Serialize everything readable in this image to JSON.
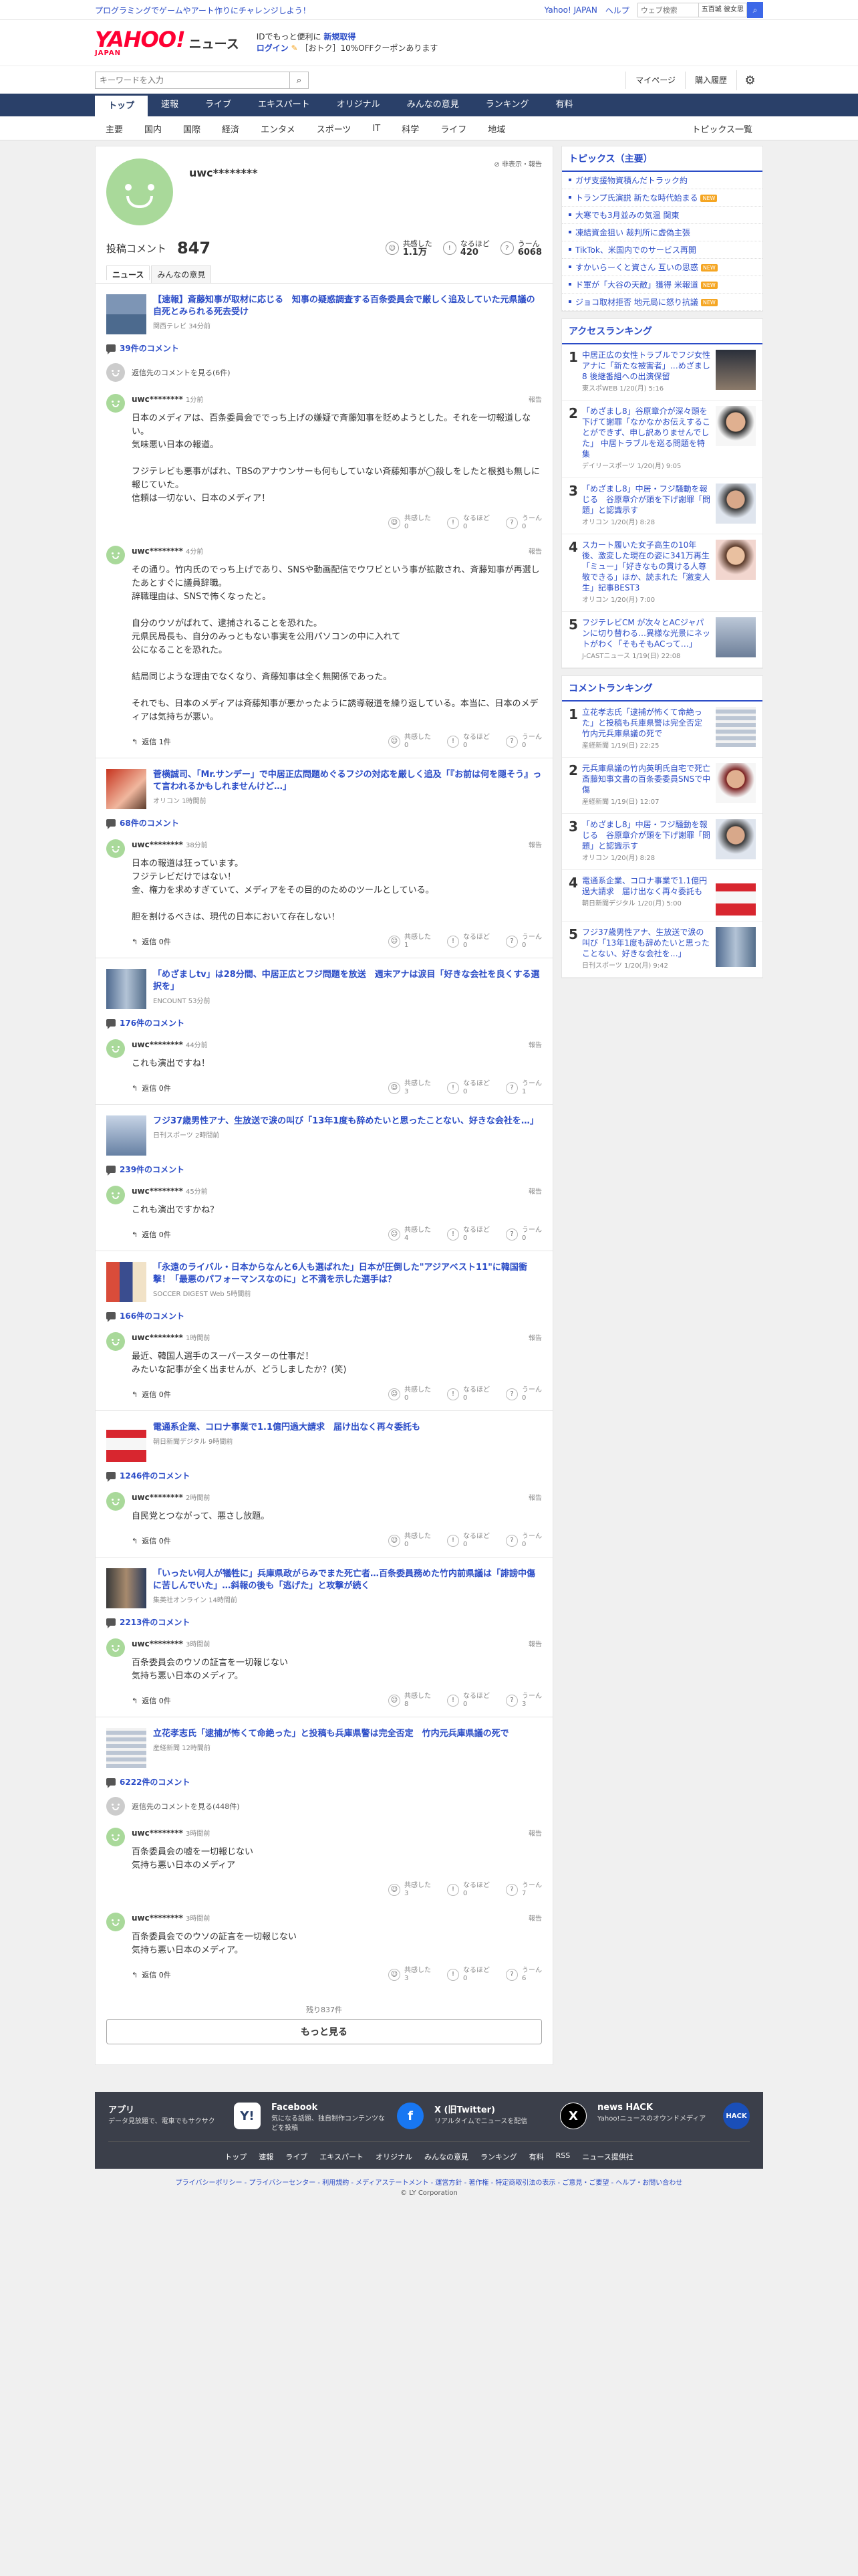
{
  "topbar": {
    "promo": "プログラミングでゲームやアート作りにチャレンジしよう！",
    "links": [
      "Yahoo! JAPAN",
      "ヘルプ"
    ],
    "search_placeholder": "ウェブ検索",
    "location": "五百城 彼女思"
  },
  "header": {
    "logo": "YAHOO!",
    "logo_sub": "JAPAN",
    "section": "ニュース",
    "msg1_prefix": "IDでもっと便利に",
    "msg1_link": "新規取得",
    "msg2_link": "ログイン",
    "msg2_suffix": "［おトク］10%OFFクーポンあります"
  },
  "search": {
    "placeholder": "キーワードを入力",
    "mypage": "マイページ",
    "history": "購入履歴"
  },
  "globalnav": [
    "トップ",
    "速報",
    "ライブ",
    "エキスパート",
    "オリジナル",
    "みんなの意見",
    "ランキング",
    "有料"
  ],
  "subnav": [
    "主要",
    "国内",
    "国際",
    "経済",
    "エンタメ",
    "スポーツ",
    "IT",
    "科学",
    "ライフ",
    "地域"
  ],
  "subnav_more": "トピックス一覧",
  "profile": {
    "username": "uwc********",
    "tools": "非表示・報告",
    "comments_label": "投稿コメント",
    "comments_count": "847",
    "reactions": [
      {
        "label": "共感した",
        "value": "1.1万"
      },
      {
        "label": "なるほど",
        "value": "420"
      },
      {
        "label": "うーん",
        "value": "6068"
      }
    ],
    "tabs": [
      "ニュース",
      "みんなの意見"
    ]
  },
  "labels": {
    "report": "報告",
    "empathy": "共感した",
    "naruhodo": "なるほど",
    "uun": "うーん"
  },
  "articles": [
    {
      "title": "【速報】斎藤知事が取材に応じる　知事の疑惑調査する百条委員会で厳しく追及していた元県議の自死とみられる死去受け",
      "source": "関西テレビ 34分前",
      "count": "39件のコメント",
      "replyto": "返信先のコメントを見る(6件)",
      "comments": [
        {
          "user": "uwc********",
          "time": "1分前",
          "text": "日本のメディアは、百条委員会ででっち上げの嫌疑で斉藤知事を貶めようとした。それを一切報道しない。\n気味悪い日本の報道。\n\nフジテレビも悪事がばれ、TBSのアナウンサーも何もしていない斉藤知事が◯殺しをしたと根拠も無しに報じていた。\n信頼は一切ない、日本のメディア！",
          "replies": "",
          "r": [
            "0",
            "0",
            "0"
          ]
        },
        {
          "user": "uwc********",
          "time": "4分前",
          "text": "その通り。竹内氏のでっち上げであり、SNSや動画配信でウワビという事が拡散され、斉藤知事が再選したあとすぐに議員辞職。\n辞職理由は、SNSで怖くなったと。\n\n自分のウソがばれて、逮捕されることを恐れた。\n元県民局長も、自分のみっともない事実を公用パソコンの中に入れて\n公になることを恐れた。\n\n結局同じような理由でなくなり、斉藤知事は全く無関係であった。\n\nそれでも、日本のメディアは斉藤知事が悪かったように誘導報道を繰り返している。本当に、日本のメディアは気持ちが悪い。",
          "replies": "返信 1件",
          "r": [
            "0",
            "0",
            "0"
          ]
        }
      ]
    },
    {
      "title": "菅横誠司、「Mr.サンデー」で中居正広問題めぐるフジの対応を厳しく追及「『お前は何を隠そう』って言われるかもしれませんけど…」",
      "source": "オリコン 1時間前",
      "count": "68件のコメント",
      "replyto": "",
      "comments": [
        {
          "user": "uwc********",
          "time": "38分前",
          "text": "日本の報道は狂っています。\nフジテレビだけではない！\n金、権力を求めすぎていて、メディアをその目的のためのツールとしている。\n\n胆を割けるべきは、現代の日本において存在しない！",
          "replies": "返信 0件",
          "r": [
            "1",
            "0",
            "0"
          ]
        }
      ]
    },
    {
      "title": "「めざましtv」は28分間、中居正広とフジ問題を放送　週末アナは涙目「好きな会社を良くする選択を」",
      "source": "ENCOUNT 53分前",
      "count": "176件のコメント",
      "replyto": "",
      "comments": [
        {
          "user": "uwc********",
          "time": "44分前",
          "text": "これも演出ですね！",
          "replies": "返信 0件",
          "r": [
            "3",
            "0",
            "1"
          ]
        }
      ]
    },
    {
      "title": "フジ37歳男性アナ、生放送で涙の叫び「13年1度も辞めたいと思ったことない、好きな会社を…」",
      "source": "日刊スポーツ 2時間前",
      "count": "239件のコメント",
      "replyto": "",
      "comments": [
        {
          "user": "uwc********",
          "time": "45分前",
          "text": "これも演出ですかね？",
          "replies": "返信 0件",
          "r": [
            "4",
            "0",
            "0"
          ]
        }
      ]
    },
    {
      "title": "「永遠のライバル・日本からなんと6人も選ばれた」日本が圧倒した\"アジアベスト11\"に韓国衝撃！「最悪のパフォーマンスなのに」と不満を示した選手は？",
      "source": "SOCCER DIGEST Web 5時間前",
      "count": "166件のコメント",
      "replyto": "",
      "comments": [
        {
          "user": "uwc********",
          "time": "1時間前",
          "text": "最近、韓国人選手のスーパースターの仕事だ！\nみたいな記事が全く出ませんが、どうしましたか？(笑)",
          "replies": "返信 0件",
          "r": [
            "0",
            "0",
            "0"
          ]
        }
      ]
    },
    {
      "title": "電通系企業、コロナ事業で1.1億円過大請求　届け出なく再々委託も",
      "source": "朝日新聞デジタル 9時間前",
      "count": "1246件のコメント",
      "replyto": "",
      "comments": [
        {
          "user": "uwc********",
          "time": "2時間前",
          "text": "自民党とつながって、悪さし放題。",
          "replies": "返信 0件",
          "r": [
            "0",
            "0",
            "0"
          ]
        }
      ]
    },
    {
      "title": "「いったい何人が犠牲に」兵庫県政がらみでまた死亡者…百条委員務めた竹内前県議は「誹謗中傷に苦しんでいた」…斜報の後も「逃げた」と攻撃が続く",
      "source": "集英社オンライン 14時間前",
      "count": "2213件のコメント",
      "replyto": "",
      "comments": [
        {
          "user": "uwc********",
          "time": "3時間前",
          "text": "百条委員会のウソの証言を一切報じない\n気持ち悪い日本のメディア。",
          "replies": "返信 0件",
          "r": [
            "8",
            "0",
            "3"
          ]
        }
      ]
    },
    {
      "title": "立花孝志氏「逮捕が怖くて命絶った」と投稿も兵庫県警は完全否定　竹内元兵庫県議の死で",
      "source": "産経新聞 12時間前",
      "count": "6222件のコメント",
      "replyto": "返信先のコメントを見る(448件)",
      "comments": [
        {
          "user": "uwc********",
          "time": "3時間前",
          "text": "百条委員会の嘘を一切報じない\n気持ち悪い日本のメディア",
          "replies": "",
          "r": [
            "3",
            "0",
            "7"
          ]
        },
        {
          "user": "uwc********",
          "time": "3時間前",
          "text": "百条委員会でのウソの証言を一切報じない\n気持ち悪い日本のメディア。",
          "replies": "返信 0件",
          "r": [
            "3",
            "0",
            "6"
          ]
        }
      ]
    }
  ],
  "remaining": "残り837件",
  "more_button": "もっと見る",
  "side": {
    "topics_title": "トピックス（主要）",
    "topics": [
      {
        "text": "ガザ支援物資積んだトラック約",
        "new": ""
      },
      {
        "text": "トランプ氏演説 新たな時代始まる",
        "new": "NEW"
      },
      {
        "text": "大寒でも3月並みの気温 関東",
        "new": ""
      },
      {
        "text": "凍結資金狙い 裁判所に虚偽主張",
        "new": ""
      },
      {
        "text": "TikTok、米国内でのサービス再開",
        "new": ""
      },
      {
        "text": "すかいらーくと資さん 互いの思惑",
        "new": "NEW"
      },
      {
        "text": "ド軍が「大谷の天敵」獲得 米報道",
        "new": "NEW"
      },
      {
        "text": "ジョコ取材拒否 地元局に怒り抗議",
        "new": "NEW"
      }
    ],
    "access_title": "アクセスランキング",
    "access": [
      {
        "n": "1",
        "text": "中居正広の女性トラブルでフジ女性アナに「新たな被害者」…めざまし8 後継番組への出演保留",
        "src": "東スポWEB 1/20(月) 5:16"
      },
      {
        "n": "2",
        "text": "「めざまし8」谷原章介が深々頭を下げて謝罪「なかなかお伝えすることができず、申し訳ありませんでした」 中居トラブルを巡る問題を特集",
        "src": "デイリースポーツ 1/20(月) 9:05"
      },
      {
        "n": "3",
        "text": "「めざまし8」中居・フジ騒動を報じる　谷原章介が頭を下げ謝罪「問題」と認識示す",
        "src": "オリコン 1/20(月) 8:28"
      },
      {
        "n": "4",
        "text": "スカート履いた女子高生の10年後、激変した現在の姿に341万再生「ミュー」「好きなもの貫ける人尊敬できる」ほか、読まれた「激変人生」記事BEST3",
        "src": "オリコン 1/20(月) 7:00"
      },
      {
        "n": "5",
        "text": "フジテレビCM が次々とACジャパンに切り替わる…異様な光景にネットがわく「そもそもACって…」",
        "src": "J-CASTニュース 1/19(日) 22:08"
      }
    ],
    "comment_title": "コメントランキング",
    "comment_rank": [
      {
        "n": "1",
        "text": "立花孝志氏「逮捕が怖くて命絶った」と投稿も兵庫県警は完全否定 竹内元兵庫県議の死で",
        "src": "産経新聞 1/19(日) 22:25"
      },
      {
        "n": "2",
        "text": "元兵庫県議の竹内英明氏自宅で死亡　斎藤知事文書の百条委委員SNSで中傷",
        "src": "産経新聞 1/19(日) 12:07"
      },
      {
        "n": "3",
        "text": "「めざまし8」中居・フジ騒動を報じる　谷原章介が頭を下げ謝罪「問題」と認識示す",
        "src": "オリコン 1/20(月) 8:28"
      },
      {
        "n": "4",
        "text": "電通系企業、コロナ事業で1.1億円過大請求　届け出なく再々委託も",
        "src": "朝日新聞デジタル 1/20(月) 5:00"
      },
      {
        "n": "5",
        "text": "フジ37歳男性アナ、生放送で涙の叫び「13年1度も辞めたいと思ったことない、好きな会社を…」",
        "src": "日刊スポーツ 1/20(月) 9:42"
      }
    ]
  },
  "footer": {
    "apps": [
      {
        "title": "アプリ",
        "desc": "データ見放題で、電車でもサクサク",
        "icon": "Y!"
      },
      {
        "title": "Facebook",
        "desc": "気になる話題、独自制作コンテンツなどを投稿",
        "icon": "f"
      },
      {
        "title": "X (旧Twitter)",
        "desc": "リアルタイムでニュースを配信",
        "icon": "X"
      },
      {
        "title": "news HACK",
        "desc": "Yahoo!ニュースのオウンドメディア",
        "icon": "HACK"
      }
    ],
    "nav": [
      "トップ",
      "速報",
      "ライブ",
      "エキスパート",
      "オリジナル",
      "みんなの意見",
      "ランキング",
      "有料",
      "RSS",
      "ニュース提供社"
    ],
    "legal": "プライバシーポリシー - プライバシーセンター - 利用規約 - メディアステートメント - 運営方針 - 著作権 - 特定商取引法の表示 - ご意見・ご要望 - ヘルプ・お問い合わせ",
    "copyright": "© LY Corporation"
  }
}
